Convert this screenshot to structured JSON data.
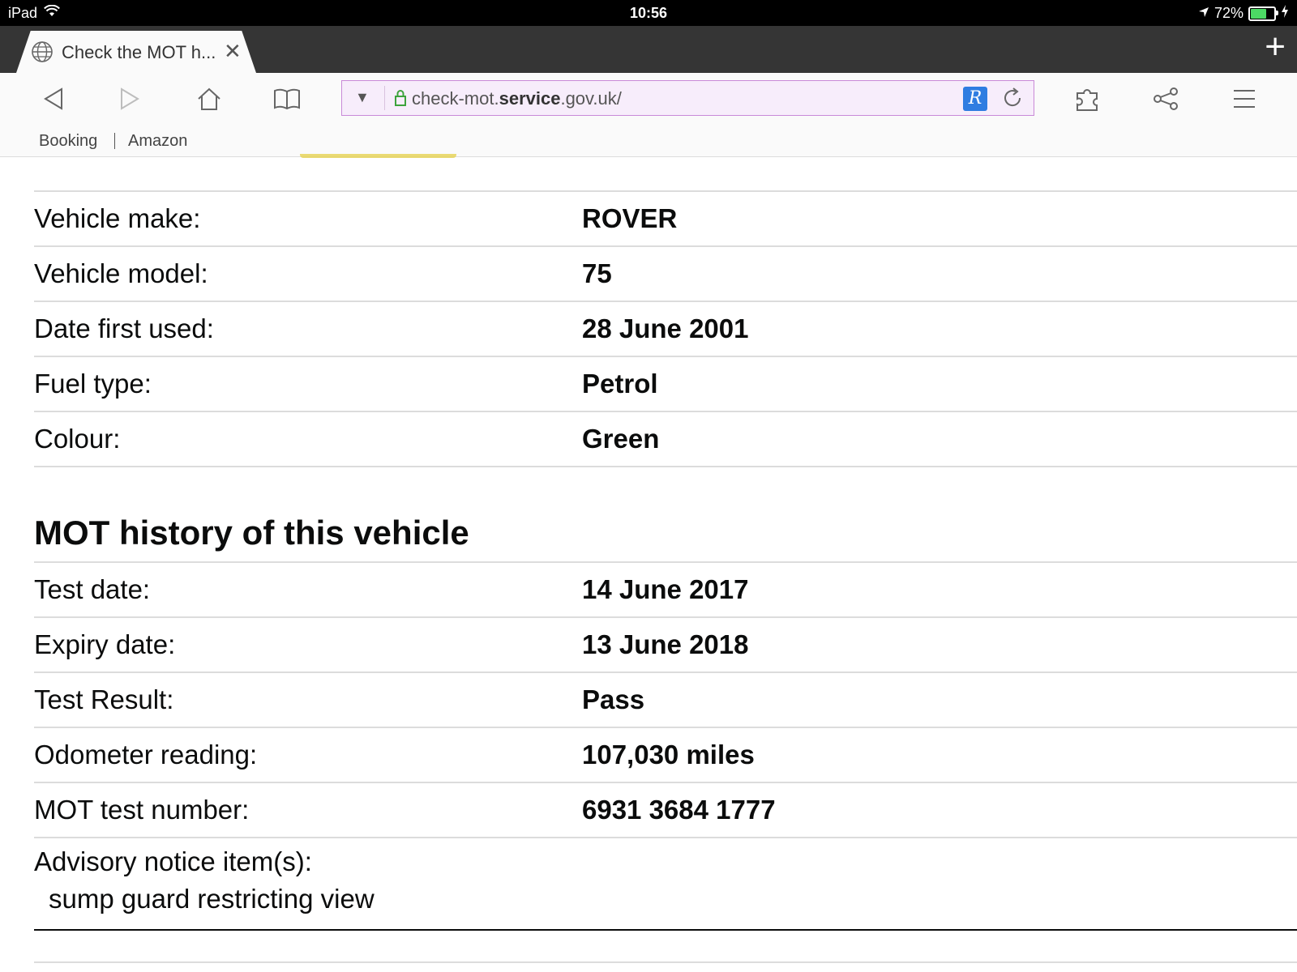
{
  "status_bar": {
    "device": "iPad",
    "time": "10:56",
    "battery_pct": "72%",
    "battery_level": 0.72
  },
  "browser": {
    "tab_title": "Check the MOT h...",
    "url_prefix": "check-mot.",
    "url_bold": "service",
    "url_suffix": ".gov.uk/",
    "bookmarks": [
      "Booking",
      "Amazon"
    ],
    "address_bar_bg": "#f7edfb",
    "extension_color": "#2f7de1"
  },
  "vehicle": [
    {
      "label": "Vehicle make:",
      "value": "ROVER"
    },
    {
      "label": "Vehicle model:",
      "value": "75"
    },
    {
      "label": "Date first used:",
      "value": "28 June 2001"
    },
    {
      "label": "Fuel type:",
      "value": "Petrol"
    },
    {
      "label": "Colour:",
      "value": "Green"
    }
  ],
  "mot_history": {
    "heading": "MOT history of this vehicle",
    "rows": [
      {
        "label": "Test date:",
        "value": "14 June 2017"
      },
      {
        "label": "Expiry date:",
        "value": "13 June 2018"
      },
      {
        "label": "Test Result:",
        "value": "Pass"
      },
      {
        "label": "Odometer reading:",
        "value": "107,030 miles"
      },
      {
        "label": "MOT test number:",
        "value": "6931 3684 1777"
      }
    ],
    "advisory_label": "Advisory notice item(s):",
    "advisory_items": [
      "sump guard restricting view"
    ]
  }
}
